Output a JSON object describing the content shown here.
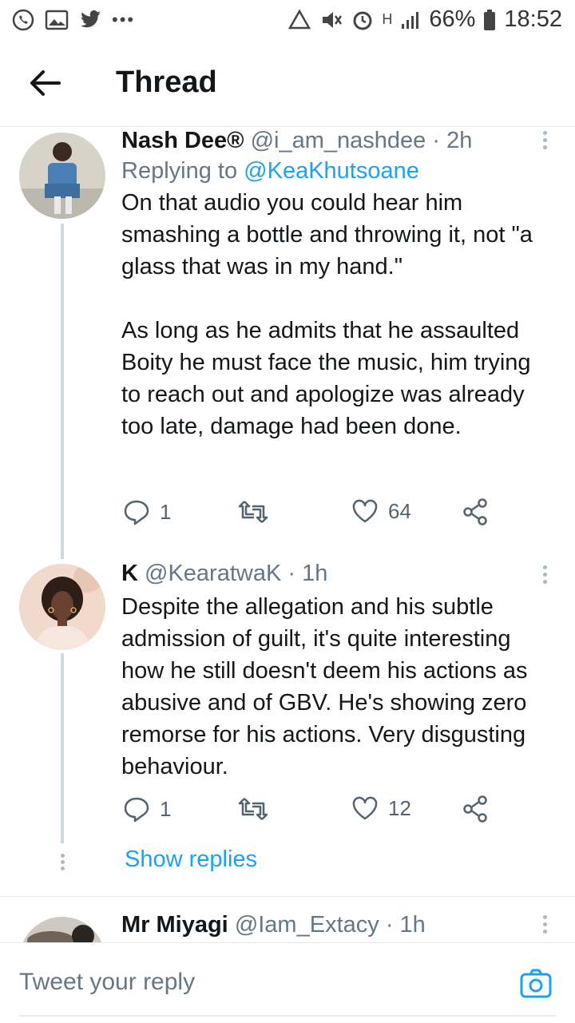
{
  "status_bar": {
    "battery": "66%",
    "time": "18:52",
    "network": "H"
  },
  "header": {
    "title": "Thread"
  },
  "tweets": [
    {
      "name": "Nash Dee®",
      "handle": "@i_am_nashdee",
      "time": "· 2h",
      "replying_label": "Replying to",
      "replying_to": "@KeaKhutsoane",
      "text": "On that audio you could hear him smashing a bottle and throwing it, not \"a glass that was in my hand.\"\n\nAs long as he admits that he assaulted Boity he must face the music, him trying to reach out and apologize was already too late, damage had been done.",
      "replies": "1",
      "likes": "64"
    },
    {
      "name": "K",
      "handle": "@KearatwaK",
      "time": "· 1h",
      "text": "Despite the allegation and his subtle admission of guilt, it's quite interesting how he still doesn't deem his actions as abusive and of GBV. He's showing zero remorse for his actions. Very disgusting behaviour.",
      "replies": "1",
      "likes": "12"
    },
    {
      "name": "Mr Miyagi",
      "handle": "@Iam_Extacy",
      "time": "· 1h"
    }
  ],
  "show_replies": "Show replies",
  "reply_bar": {
    "placeholder": "Tweet your reply"
  },
  "colors": {
    "accent": "#1da1f2",
    "text": "#14171a",
    "muted": "#657786"
  }
}
